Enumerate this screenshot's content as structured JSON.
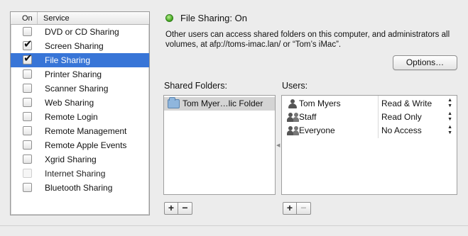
{
  "service_list": {
    "header_on": "On",
    "header_service": "Service",
    "items": [
      {
        "label": "DVD or CD Sharing",
        "checked": false,
        "selected": false,
        "enabled": true
      },
      {
        "label": "Screen Sharing",
        "checked": true,
        "selected": false,
        "enabled": true
      },
      {
        "label": "File Sharing",
        "checked": true,
        "selected": true,
        "enabled": true
      },
      {
        "label": "Printer Sharing",
        "checked": false,
        "selected": false,
        "enabled": true
      },
      {
        "label": "Scanner Sharing",
        "checked": false,
        "selected": false,
        "enabled": true
      },
      {
        "label": "Web Sharing",
        "checked": false,
        "selected": false,
        "enabled": true
      },
      {
        "label": "Remote Login",
        "checked": false,
        "selected": false,
        "enabled": true
      },
      {
        "label": "Remote Management",
        "checked": false,
        "selected": false,
        "enabled": true
      },
      {
        "label": "Remote Apple Events",
        "checked": false,
        "selected": false,
        "enabled": true
      },
      {
        "label": "Xgrid Sharing",
        "checked": false,
        "selected": false,
        "enabled": true
      },
      {
        "label": "Internet Sharing",
        "checked": false,
        "selected": false,
        "enabled": false
      },
      {
        "label": "Bluetooth Sharing",
        "checked": false,
        "selected": false,
        "enabled": true
      }
    ],
    "selected_color": "#3875d7"
  },
  "status": {
    "title": "File Sharing: On",
    "description": "Other users can access shared folders on this computer, and administrators all volumes, at afp://toms-imac.lan/ or “Tom’s iMac”.",
    "indicator_color": "#3ca21a"
  },
  "options_button_label": "Options…",
  "shared_folders": {
    "label": "Shared Folders:",
    "items": [
      {
        "name": "Tom Myer…lic Folder",
        "icon": "folder-icon"
      }
    ]
  },
  "users": {
    "label": "Users:",
    "items": [
      {
        "name": "Tom Myers",
        "icon": "user-icon",
        "permission": "Read & Write"
      },
      {
        "name": "Staff",
        "icon": "group-icon",
        "permission": "Read Only"
      },
      {
        "name": "Everyone",
        "icon": "group-icon",
        "permission": "No Access"
      }
    ]
  },
  "buttons": {
    "add_symbol": "+",
    "remove_symbol": "−",
    "stepper_arrows": "▲▼"
  }
}
